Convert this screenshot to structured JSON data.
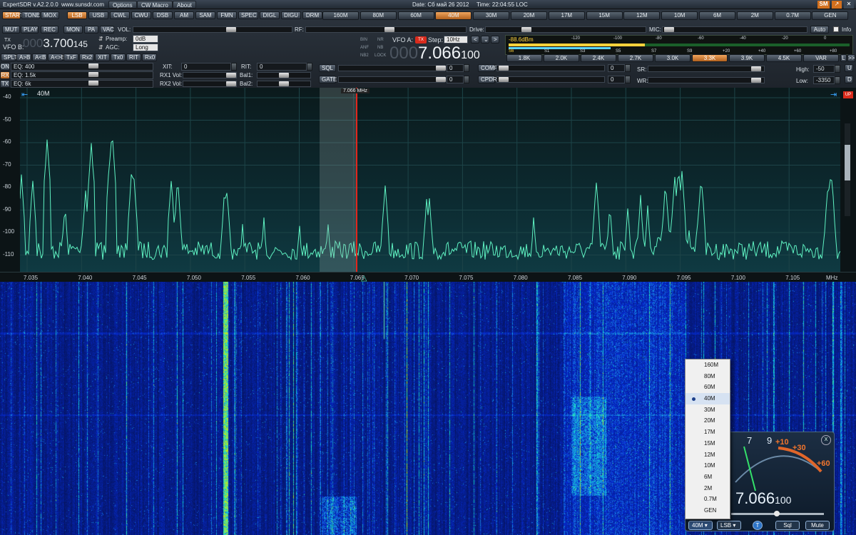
{
  "titlebar": {
    "app": "ExpertSDR v.A2.2.0.0",
    "site": "www.sunsdr.com",
    "menu": [
      "Options",
      "CW Macro",
      "About"
    ],
    "date": "Date: Сб май 26 2012",
    "time": "Time: 22:04:55 LOC",
    "sm": "SM"
  },
  "row1": {
    "buttons": [
      "START",
      "TONE",
      "MOX"
    ],
    "modes": [
      "LSB",
      "USB",
      "CWL",
      "CWU",
      "DSB",
      "AM",
      "SAM",
      "FMN",
      "SPEC",
      "DIGL",
      "DIGU",
      "DRM"
    ],
    "bands": [
      "160M",
      "80M",
      "60M",
      "40M",
      "30M",
      "20M",
      "17M",
      "15M",
      "12M",
      "10M",
      "6M",
      "2M",
      "0.7M",
      "GEN"
    ]
  },
  "row2": {
    "buttons": [
      "MUT",
      "PLAY",
      "REC",
      "MON",
      "PA",
      "VAC"
    ],
    "vol": "VOL:",
    "rf": "RF:",
    "drive": "Drive:",
    "mic": "MIC:",
    "auto": "Auto",
    "info": "Info"
  },
  "vfo_b": {
    "tx": "TX",
    "label": "VFO B:",
    "dim": "000",
    "main": "3.700",
    "small": "145",
    "preamp_label": "Preamp:",
    "preamp": "0dB",
    "agc_label": "AGC:",
    "agc": "Long"
  },
  "row4": [
    "SPLT",
    "A>B",
    "A<B",
    "A<>B",
    "TxF",
    "Rx2",
    "XIT",
    "Tx0",
    "RIT",
    "Rx0"
  ],
  "vfo_a": {
    "flags": [
      "BIN",
      "NR",
      "ANF",
      "NB",
      "NB2",
      "LOCK"
    ],
    "label": "VFO A:",
    "tx": "TX",
    "step_label": "Step:",
    "step": "10Hz",
    "dim": "000",
    "main": "7.066",
    "small": "100"
  },
  "smeter": {
    "dbm": "-88.6dBm",
    "top_ticks": [
      "-120",
      "-100",
      "-80",
      "-60",
      "-40",
      "-20",
      "0"
    ],
    "s_ticks": [
      "S6",
      "S1",
      "S3",
      "S5",
      "S7",
      "S9",
      "+20",
      "+40",
      "+60",
      "+80"
    ],
    "level": 0.3
  },
  "filters": {
    "items": [
      "1.8K",
      "2.0K",
      "2.4K",
      "2.7K",
      "3.0K",
      "3.3K",
      "3.9K",
      "4.5K",
      "VAR"
    ],
    "selected": "3.3K",
    "l": "L",
    "next": ">>"
  },
  "eq_rows": [
    {
      "tag": "ON",
      "label": "EQ: 400"
    },
    {
      "tag": "RX",
      "label": "EQ: 1.5k"
    },
    {
      "tag": "TX",
      "label": "EQ: 6k"
    }
  ],
  "mid": {
    "xit": "XIT:",
    "xit_val": "0",
    "rit": "RIT:",
    "rit_val": "0",
    "rx1": "RX1 Vol:",
    "bal1": "Bal1:",
    "rx2": "RX2 Vol:",
    "bal2": "Bal2:"
  },
  "dsp": {
    "sql": "SQL",
    "sql_val": "0",
    "gate": "GATE",
    "gate_val": "0",
    "comp": "COMP",
    "comp_val": "0",
    "cpdr": "CPDR",
    "cpdr_val": "0",
    "sr": "SR:",
    "wr": "WR:",
    "high": "High:",
    "high_val": "-50",
    "low": "Low:",
    "low_val": "-3350",
    "u": "U",
    "d": "D"
  },
  "spectrum": {
    "band": "40M",
    "marker": "7.066 MHz",
    "up": "UP",
    "db_ticks": [
      "-40",
      "-50",
      "-60",
      "-70",
      "-80",
      "-90",
      "-100",
      "-110"
    ],
    "freq_ticks": [
      "7.035",
      "7.040",
      "7.045",
      "7.050",
      "7.055",
      "7.060",
      "7.065",
      "7.070",
      "7.075",
      "7.080",
      "7.085",
      "7.090",
      "7.095",
      "7.100",
      "7.105"
    ],
    "unit": "MHz"
  },
  "band_menu": {
    "items": [
      "160M",
      "80M",
      "60M",
      "40M",
      "30M",
      "20M",
      "17M",
      "15M",
      "12M",
      "10M",
      "6M",
      "2M",
      "0.7M",
      "GEN"
    ],
    "selected": "40M"
  },
  "mini": {
    "close": "X",
    "scale": [
      "7",
      "9",
      "+10",
      "+30",
      "+60"
    ],
    "freq": "7.066",
    "freq_small": "100",
    "band": "40M",
    "mode": "LSB",
    "t": "T",
    "sql": "Sql",
    "mute": "Mute"
  }
}
